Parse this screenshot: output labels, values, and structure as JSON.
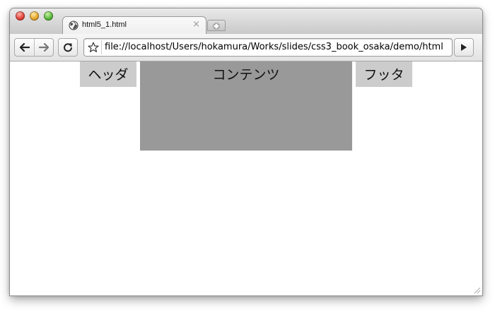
{
  "window": {
    "tab": {
      "title": "html5_1.html",
      "close_glyph": "×"
    },
    "favicon_icon": "globe-icon",
    "new_tab_icon": "plus-icon"
  },
  "toolbar": {
    "back_icon": "arrow-left-icon",
    "forward_icon": "arrow-right-icon",
    "reload_icon": "reload-icon",
    "bookmark_icon": "star-icon",
    "url": "file://localhost/Users/hokamura/Works/slides/css3_book_osaka/demo/html",
    "go_icon": "play-icon"
  },
  "page": {
    "header_text": "ヘッダ",
    "content_text": "コンテンツ",
    "footer_text": "フッタ",
    "colors": {
      "header": "#cccccc",
      "content": "#999999",
      "footer": "#cccccc"
    }
  }
}
